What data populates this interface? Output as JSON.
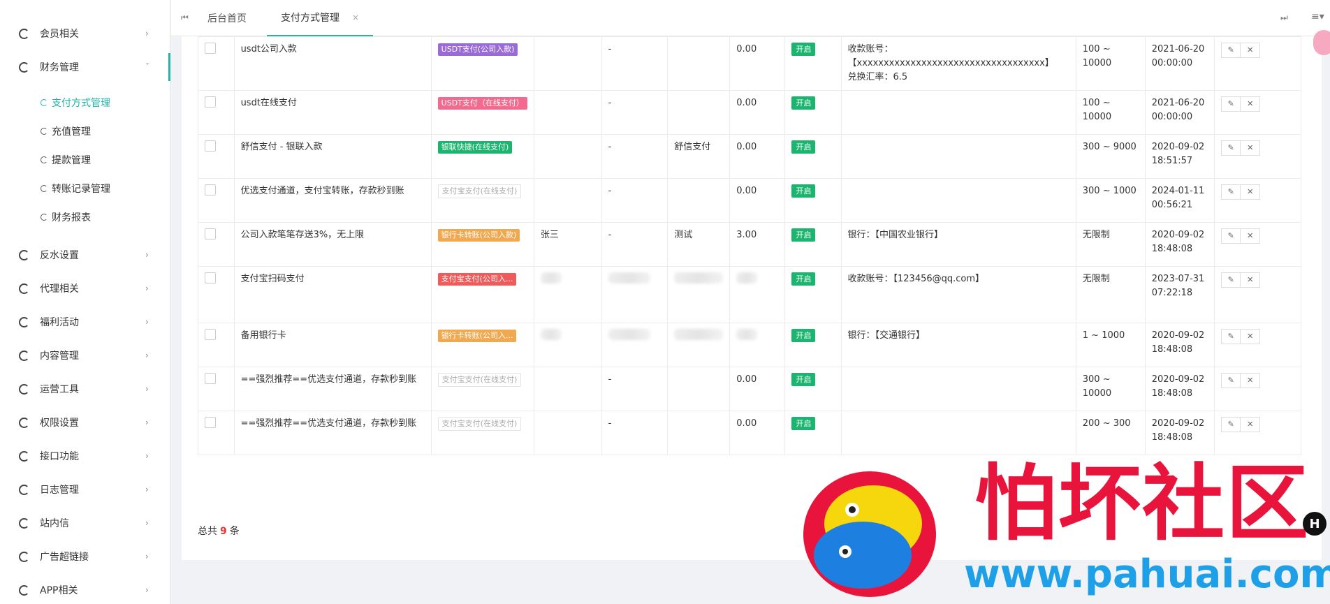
{
  "sidebar": {
    "items": [
      {
        "label": "会员相关",
        "arrow": "›"
      },
      {
        "label": "财务管理",
        "arrow": "ˇ"
      },
      {
        "label": "反水设置",
        "arrow": "›"
      },
      {
        "label": "代理相关",
        "arrow": "›"
      },
      {
        "label": "福利活动",
        "arrow": "›"
      },
      {
        "label": "内容管理",
        "arrow": "›"
      },
      {
        "label": "运营工具",
        "arrow": "›"
      },
      {
        "label": "权限设置",
        "arrow": "›"
      },
      {
        "label": "接口功能",
        "arrow": "›"
      },
      {
        "label": "日志管理",
        "arrow": "›"
      },
      {
        "label": "站内信",
        "arrow": "›"
      },
      {
        "label": "广告超链接",
        "arrow": "›"
      },
      {
        "label": "APP相关",
        "arrow": "›"
      }
    ],
    "finance_sub": [
      {
        "label": "支付方式管理"
      },
      {
        "label": "充值管理"
      },
      {
        "label": "提款管理"
      },
      {
        "label": "转账记录管理"
      },
      {
        "label": "财务报表"
      }
    ]
  },
  "topbar": {
    "first_icon": "⏮",
    "last_icon": "⏭",
    "menu_icon": "≡▾",
    "tabs": [
      {
        "label": "后台首页"
      },
      {
        "label": "支付方式管理",
        "close": "×"
      }
    ]
  },
  "table": {
    "rows": [
      {
        "name": "usdt公司入款",
        "badge": "USDT支付(公司入款)",
        "badge_color": "#9a6bd6",
        "account_name": "",
        "col4": "-",
        "col5": "",
        "fee": "0.00",
        "status": "开启",
        "info1": "收款账号：【xxxxxxxxxxxxxxxxxxxxxxxxxxxxxxxxxxx】",
        "info2": "兑换汇率：6.5",
        "range": "100 ~ 10000",
        "date": "2021-06-20",
        "time": "00:00:00"
      },
      {
        "name": "usdt在线支付",
        "badge": "USDT支付（在线支付）",
        "badge_color": "#f46a8e",
        "account_name": "",
        "col4": "-",
        "col5": "",
        "fee": "0.00",
        "status": "开启",
        "info1": "",
        "info2": "",
        "range": "100 ~ 10000",
        "date": "2021-06-20",
        "time": "00:00:00"
      },
      {
        "name": "舒信支付 - 银联入款",
        "badge": "银联快捷(在线支付)",
        "badge_color": "#1bb56f",
        "account_name": "",
        "col4": "-",
        "col5": "舒信支付",
        "fee": "0.00",
        "status": "开启",
        "info1": "",
        "info2": "",
        "range": "300 ~ 9000",
        "date": "2020-09-02",
        "time": "18:51:57"
      },
      {
        "name": "优选支付通道，支付宝转账，存款秒到账",
        "badge": "支付宝支付(在线支付)",
        "badge_color": "gray",
        "account_name": "",
        "col4": "-",
        "col5": "",
        "fee": "0.00",
        "status": "开启",
        "info1": "",
        "info2": "",
        "range": "300 ~ 1000",
        "date": "2024-01-11",
        "time": "00:56:21"
      },
      {
        "name": "公司入款笔笔存送3%，无上限",
        "badge": "银行卡转账(公司入款)",
        "badge_color": "#f0a94f",
        "account_name": "张三",
        "col4": "-",
        "col5": "测试",
        "fee": "3.00",
        "status": "开启",
        "info1": "银行：【中国农业银行】",
        "info2": "",
        "range": "无限制",
        "date": "2020-09-02",
        "time": "18:48:08"
      },
      {
        "name": "支付宝扫码支付",
        "badge": "支付宝支付(公司入...",
        "badge_color": "#ef5a5a",
        "account_name": "",
        "col4": "",
        "col5": "",
        "fee": "",
        "status": "开启",
        "info1": "收款账号：【123456@qq.com】",
        "info2": "",
        "range": "无限制",
        "date": "2023-07-31",
        "time": "07:22:18",
        "blurred": true
      },
      {
        "name": "备用银行卡",
        "badge": "银行卡转账(公司入...",
        "badge_color": "#f0a94f",
        "account_name": "",
        "col4": "",
        "col5": "",
        "fee": "",
        "status": "开启",
        "info1": "银行：【交通银行】",
        "info2": "",
        "range": "1 ~ 1000",
        "date": "2020-09-02",
        "time": "18:48:08",
        "blurred": true
      },
      {
        "name": "==强烈推荐==优选支付通道，存款秒到账",
        "badge": "支付宝支付(在线支付)",
        "badge_color": "gray",
        "account_name": "",
        "col4": "-",
        "col5": "",
        "fee": "0.00",
        "status": "开启",
        "info1": "",
        "info2": "",
        "range": "300 ~ 10000",
        "date": "2020-09-02",
        "time": "18:48:08"
      },
      {
        "name": "==强烈推荐==优选支付通道，存款秒到账",
        "badge": "支付宝支付(在线支付)",
        "badge_color": "gray",
        "account_name": "",
        "col4": "-",
        "col5": "",
        "fee": "0.00",
        "status": "开启",
        "info1": "",
        "info2": "",
        "range": "200 ~ 300",
        "date": "2020-09-02",
        "time": "18:48:08"
      }
    ],
    "edit_icon": "✎",
    "delete_icon": "✕"
  },
  "footer": {
    "total_prefix": "总共",
    "total_count": "9",
    "total_suffix": "条"
  },
  "watermark": {
    "title": "怕坏社区",
    "url": "www.pahuai.com",
    "badge_letter": "H"
  }
}
